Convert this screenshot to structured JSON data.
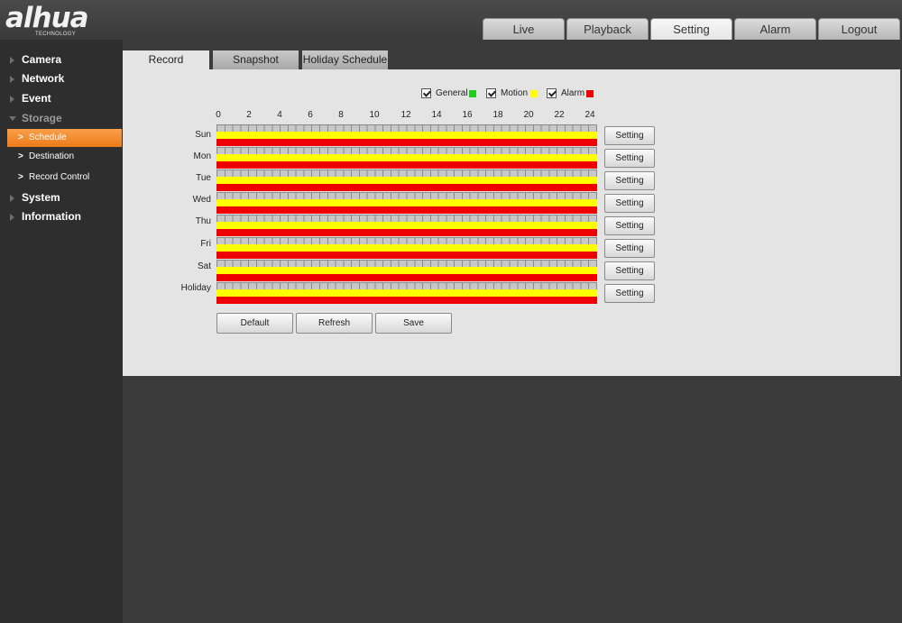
{
  "header": {
    "logo_text": "alhua",
    "logo_sub": "TECHNOLOGY",
    "tabs": [
      "Live",
      "Playback",
      "Setting",
      "Alarm",
      "Logout"
    ],
    "active_tab": "Setting"
  },
  "sidebar": {
    "items": [
      {
        "label": "Camera",
        "icon": "triangle-right-icon"
      },
      {
        "label": "Network",
        "icon": "triangle-right-icon"
      },
      {
        "label": "Event",
        "icon": "triangle-right-icon"
      },
      {
        "label": "Storage",
        "icon": "triangle-down-icon"
      },
      {
        "label": "System",
        "icon": "triangle-right-icon"
      },
      {
        "label": "Information",
        "icon": "triangle-right-icon"
      }
    ],
    "storage_sub": [
      "Schedule",
      "Destination",
      "Record Control"
    ],
    "active_sub": "Schedule"
  },
  "content": {
    "tabs": [
      "Record",
      "Snapshot",
      "Holiday Schedule"
    ],
    "active_tab": "Record",
    "legend": [
      {
        "label": "General",
        "color": "#22cc22",
        "checked": true
      },
      {
        "label": "Motion",
        "color": "#ffff00",
        "checked": true
      },
      {
        "label": "Alarm",
        "color": "#ee0000",
        "checked": true
      }
    ],
    "hour_labels": [
      "0",
      "2",
      "4",
      "6",
      "8",
      "10",
      "12",
      "14",
      "16",
      "18",
      "20",
      "22",
      "24"
    ],
    "days": [
      "Sun",
      "Mon",
      "Tue",
      "Wed",
      "Thu",
      "Fri",
      "Sat",
      "Holiday"
    ],
    "schedule_colors": {
      "general_bar": "#c8c8c8",
      "motion_bar": "#ffff00",
      "alarm_bar": "#ee0000"
    },
    "setting_label": "Setting",
    "buttons": {
      "default": "Default",
      "refresh": "Refresh",
      "save": "Save"
    }
  }
}
